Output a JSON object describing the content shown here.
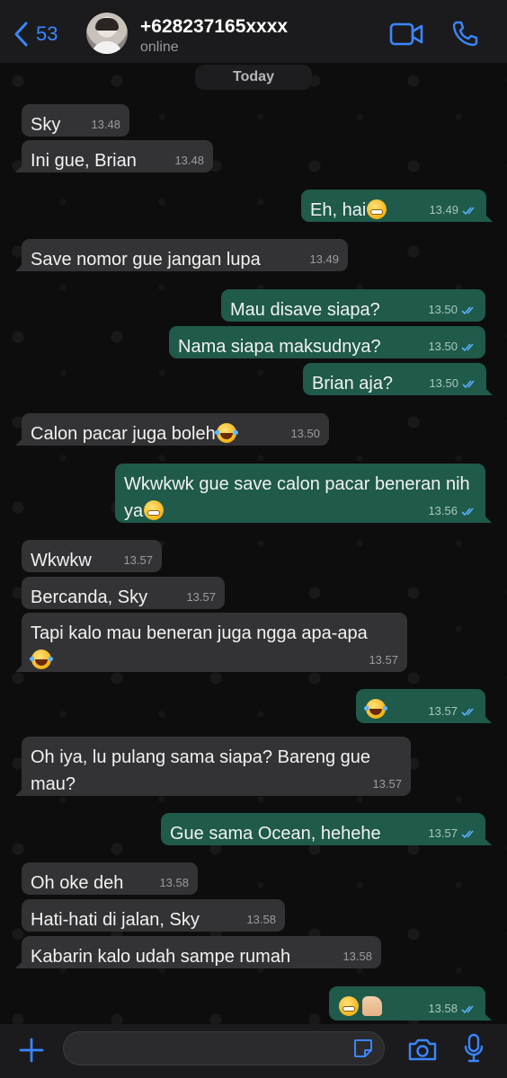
{
  "header": {
    "back_count": "53",
    "contact_name": "+628237165xxxx",
    "status": "online"
  },
  "date_label": "Today",
  "colors": {
    "incoming_bubble": "#333335",
    "outgoing_bubble": "#1f5a4a",
    "accent": "#3a86ff",
    "read_ticks": "#5ab0ff"
  },
  "messages": [
    {
      "dir": "in",
      "text": "Sky",
      "time": "13.48"
    },
    {
      "dir": "in",
      "text": "Ini gue, Brian",
      "time": "13.48"
    },
    {
      "dir": "out",
      "text": "Eh, hai",
      "emoji": "grimacing",
      "time": "13.49",
      "read": true
    },
    {
      "dir": "in",
      "text": "Save nomor gue jangan lupa",
      "time": "13.49"
    },
    {
      "dir": "out",
      "text": "Mau disave siapa?",
      "time": "13.50",
      "read": true
    },
    {
      "dir": "out",
      "text": "Nama siapa maksudnya?",
      "time": "13.50",
      "read": true
    },
    {
      "dir": "out",
      "text": "Brian aja?",
      "time": "13.50",
      "read": true
    },
    {
      "dir": "in",
      "text": "Calon pacar juga boleh",
      "emoji": "tears-of-joy",
      "time": "13.50"
    },
    {
      "dir": "out",
      "text": "Wkwkwk gue save calon pacar beneran nih ya",
      "emoji": "grimacing",
      "time": "13.56",
      "read": true
    },
    {
      "dir": "in",
      "text": "Wkwkw",
      "time": "13.57"
    },
    {
      "dir": "in",
      "text": "Bercanda, Sky",
      "time": "13.57"
    },
    {
      "dir": "in",
      "text": "Tapi kalo mau beneran juga ngga apa-apa",
      "emoji": "tears-of-joy",
      "time": "13.57"
    },
    {
      "dir": "out",
      "text": "",
      "emoji": "tears-of-joy",
      "time": "13.57",
      "read": true
    },
    {
      "dir": "in",
      "text": "Oh iya, lu pulang sama siapa? Bareng gue mau?",
      "time": "13.57"
    },
    {
      "dir": "out",
      "text": "Gue sama Ocean, hehehe",
      "time": "13.57",
      "read": true
    },
    {
      "dir": "in",
      "text": "Oh oke deh",
      "time": "13.58"
    },
    {
      "dir": "in",
      "text": "Hati-hati di jalan, Sky",
      "time": "13.58"
    },
    {
      "dir": "in",
      "text": "Kabarin kalo udah sampe rumah",
      "time": "13.58"
    },
    {
      "dir": "out",
      "text": "",
      "emoji": "grimacing, thumbs-up",
      "time": "13.58",
      "read": true
    }
  ],
  "composer": {
    "placeholder": "",
    "value": ""
  }
}
